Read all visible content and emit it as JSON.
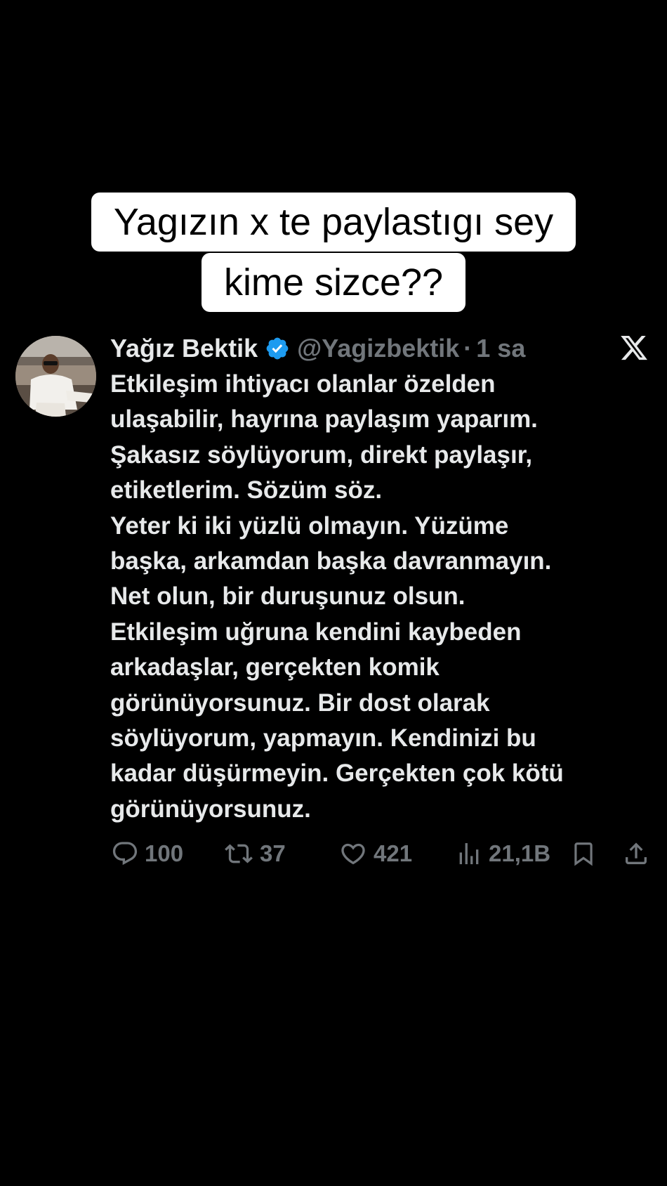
{
  "caption": {
    "line1": "Yagızın x te paylastıgı sey",
    "line2": "kime sizce??"
  },
  "tweet": {
    "author_name": "Yağız Bektik",
    "verified": true,
    "handle": "@Yagizbektik",
    "separator": "·",
    "time": "1 sa",
    "body_lines": [
      "Etkileşim ihtiyacı olanlar özelden",
      "ulaşabilir, hayrına paylaşım yaparım.",
      "Şakasız söylüyorum, direkt paylaşır,",
      "etiketlerim. Sözüm söz.",
      "Yeter ki iki yüzlü olmayın. Yüzüme",
      "başka, arkamdan başka davranmayın.",
      "Net olun, bir duruşunuz olsun.",
      "Etkileşim uğruna kendini kaybeden",
      "arkadaşlar, gerçekten komik",
      "görünüyorsunuz. Bir dost olarak",
      "söylüyorum, yapmayın. Kendinizi bu",
      "kadar düşürmeyin. Gerçekten çok kötü",
      "görünüyorsunuz."
    ],
    "actions": {
      "replies": "100",
      "retweets": "37",
      "likes": "421",
      "views": "21,1B"
    }
  },
  "icons": {
    "verified": "verified-badge-icon",
    "platform": "x-logo-icon",
    "reply": "reply-icon",
    "retweet": "retweet-icon",
    "like": "heart-icon",
    "views": "views-icon",
    "bookmark": "bookmark-icon",
    "share": "share-icon"
  },
  "colors": {
    "background": "#000000",
    "text_primary": "#e7e9ea",
    "text_secondary": "#71767b",
    "verified_blue": "#1d9bf0",
    "caption_bg": "#ffffff",
    "caption_text": "#000000"
  }
}
